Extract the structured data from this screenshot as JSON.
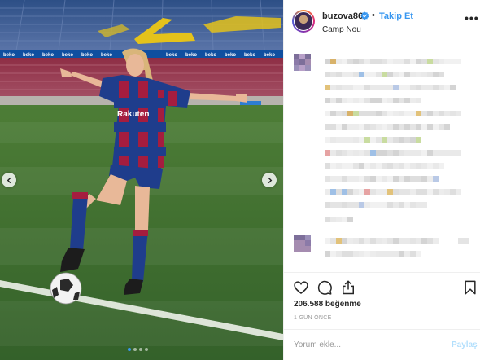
{
  "post": {
    "username": "buzova86",
    "separator": "•",
    "follow_label": "Takip Et",
    "location": "Camp Nou",
    "more_label": "•••",
    "likes": "206.588 beğenme",
    "time_ago": "1 GÜN ÖNCE",
    "comment_placeholder": "Yorum ekle...",
    "post_label": "Paylaş",
    "carousel": {
      "total_slides": 4,
      "active_index": 0
    }
  },
  "photo": {
    "jersey_sponsor": "Rakuten",
    "banner_brand": "beko"
  },
  "icons": {
    "like": "heart-icon",
    "comment": "speech-bubble-icon",
    "share": "share-icon",
    "save": "bookmark-icon",
    "verified": "verified-badge-icon",
    "prev": "chevron-left-icon",
    "next": "chevron-right-icon"
  },
  "colors": {
    "accent": "#3897f0",
    "post_disabled": "#b2dffc",
    "muted": "#999999",
    "text": "#262626"
  }
}
